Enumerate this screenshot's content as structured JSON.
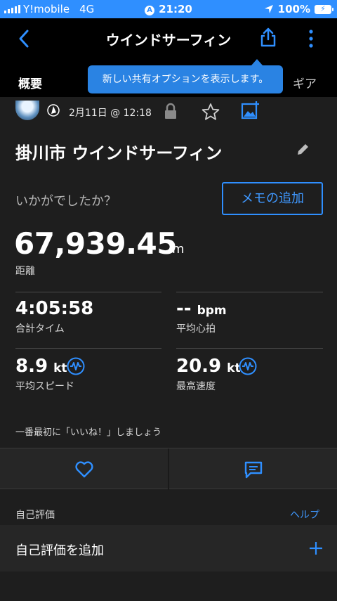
{
  "status_bar": {
    "carrier": "Y!mobile",
    "network": "4G",
    "time": "21:20",
    "battery": "100%"
  },
  "header": {
    "title": "ウインドサーフィン",
    "tabs": [
      "概要",
      "ギア"
    ],
    "tooltip": "新しい共有オプションを表示します。"
  },
  "activity": {
    "date": "2月11日 @ 12:18",
    "name": "掛川市 ウインドサーフィン",
    "question": "いかがでしたか？",
    "memo_button": "メモの追加"
  },
  "stats": {
    "distance": {
      "value": "67,939.45",
      "unit": "m",
      "label": "距離"
    },
    "total_time": {
      "value": "4:05:58",
      "label": "合計タイム"
    },
    "avg_hr": {
      "value": "--",
      "unit": "bpm",
      "label": "平均心拍"
    },
    "avg_speed": {
      "value": "8.9",
      "unit": "kt",
      "label": "平均スピード"
    },
    "max_speed": {
      "value": "20.9",
      "unit": "kt",
      "label": "最高速度"
    }
  },
  "social": {
    "kudos_prompt": "一番最初に「いいね！」しましょう"
  },
  "self_evaluation": {
    "title": "自己評価",
    "help": "ヘルプ",
    "add_label": "自己評価を追加"
  },
  "colors": {
    "accent": "#2f8fff",
    "background": "#1e1e1e",
    "header": "#000000"
  }
}
